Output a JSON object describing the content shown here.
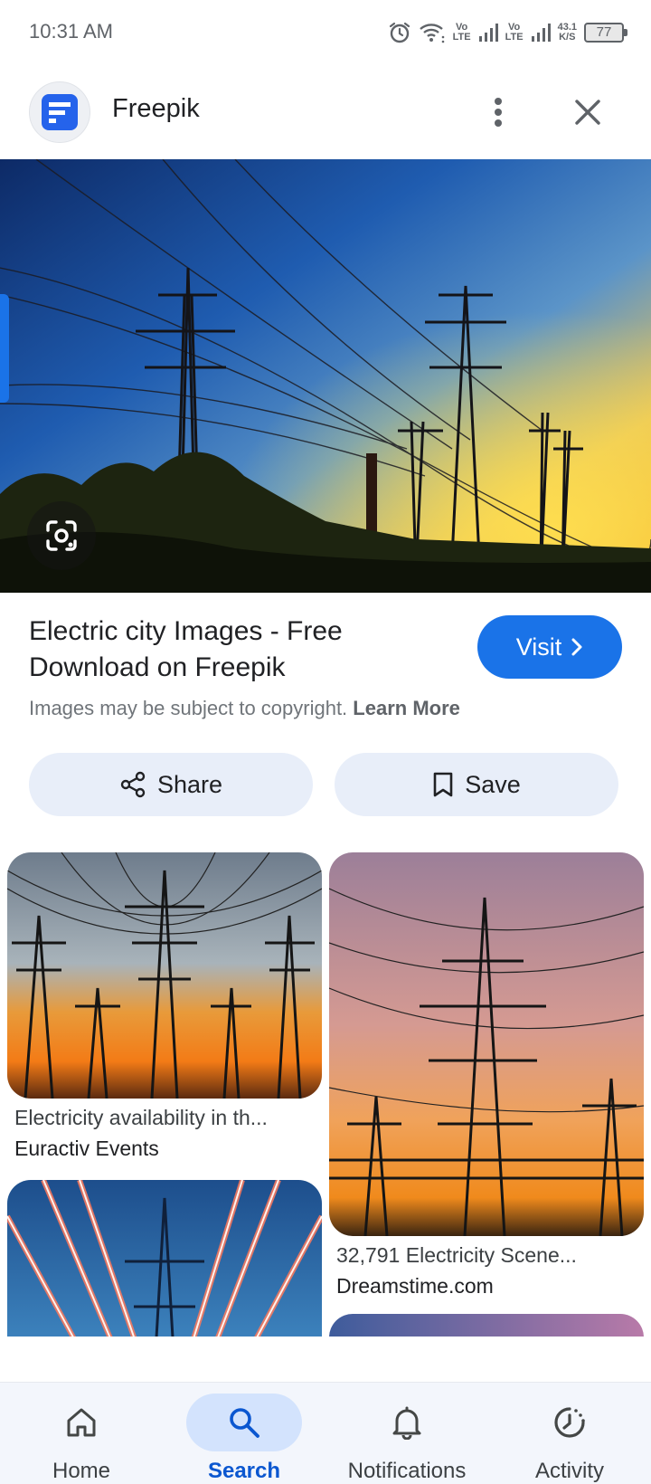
{
  "status_bar": {
    "time": "10:31 AM",
    "net_speed_value": "43.1",
    "net_speed_unit": "K/S",
    "battery": "77",
    "vo_label": "Vo",
    "lte_label": "LTE",
    "icons": [
      "alarm-icon",
      "wifi-icon",
      "signal-icon",
      "battery-icon"
    ]
  },
  "source": {
    "name": "Freepik",
    "logo_color": "#2563eb"
  },
  "result": {
    "title": "Electric city Images - Free Download on Freepik",
    "visit_label": "Visit",
    "copyright_text": "Images may be subject to copyright.",
    "learn_more": "Learn More"
  },
  "actions": {
    "share_label": "Share",
    "save_label": "Save"
  },
  "related": [
    {
      "title": "Electricity availability in th...",
      "source": "Euractiv Events"
    },
    {
      "title": "32,791 Electricity Scene...",
      "source": "Dreamstime.com"
    }
  ],
  "bottom_nav": {
    "items": [
      {
        "label": "Home",
        "icon": "home-icon"
      },
      {
        "label": "Search",
        "icon": "search-icon",
        "active": true
      },
      {
        "label": "Notifications",
        "icon": "bell-icon"
      },
      {
        "label": "Activity",
        "icon": "activity-icon"
      }
    ]
  },
  "colors": {
    "accent": "#1a73e8",
    "pill_bg": "#e8eef9",
    "nav_bg": "#f3f6fc",
    "nav_active": "#d3e3fd"
  }
}
